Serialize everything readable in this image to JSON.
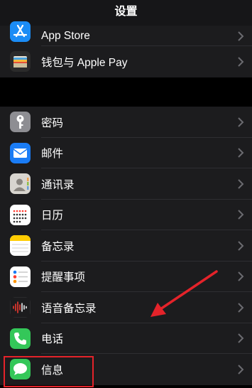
{
  "header": {
    "title": "设置"
  },
  "groups": [
    {
      "items": [
        {
          "label": "App Store",
          "icon": "app-store-icon",
          "color": "#1b8cf5"
        },
        {
          "label": "钱包与 Apple Pay",
          "icon": "wallet-icon",
          "color": "#2b2b2b"
        }
      ]
    },
    {
      "items": [
        {
          "label": "密码",
          "icon": "key-icon",
          "color": "#8e8e93"
        },
        {
          "label": "邮件",
          "icon": "mail-icon",
          "color": "#1a7cf5"
        },
        {
          "label": "通讯录",
          "icon": "contacts-icon",
          "color": "#d8d5cf"
        },
        {
          "label": "日历",
          "icon": "calendar-icon",
          "color": "#ffffff"
        },
        {
          "label": "备忘录",
          "icon": "notes-icon",
          "color": "#ffffff"
        },
        {
          "label": "提醒事项",
          "icon": "reminders-icon",
          "color": "#ffffff"
        },
        {
          "label": "语音备忘录",
          "icon": "voice-memos-icon",
          "color": "#1c1c1e"
        },
        {
          "label": "电话",
          "icon": "phone-icon",
          "color": "#34c759"
        },
        {
          "label": "信息",
          "icon": "messages-icon",
          "color": "#34c759"
        }
      ]
    }
  ],
  "annotation": {
    "highlight_color": "#e4232a",
    "arrow_color": "#e4232a"
  }
}
